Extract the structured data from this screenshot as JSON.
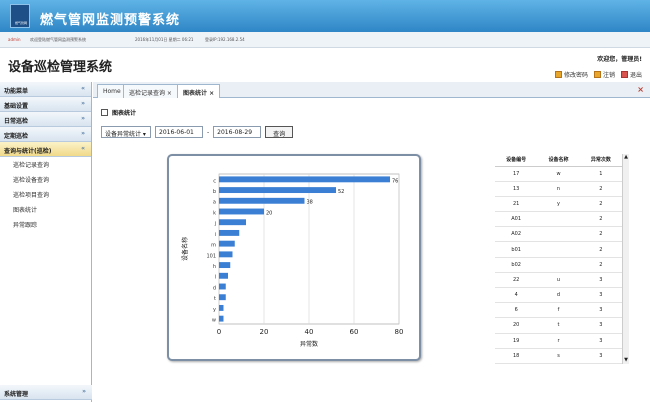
{
  "header": {
    "logo_text": "燃气管网",
    "system_title": "燃气管网监测预警系统",
    "user_link": "admin",
    "info_text": "欢迎登陆燃气管网监测预警系统",
    "datetime": "2016年11月01日 星期二 06:21",
    "ip_text": "登录IP:192.168.2.54"
  },
  "top": {
    "page_title": "设备巡检管理系统",
    "welcome": "欢迎您，管理员!",
    "links": [
      "修改密码",
      "注销",
      "退出"
    ]
  },
  "sidebar": {
    "sections": [
      {
        "label": "功能菜单",
        "chev": "«"
      },
      {
        "label": "基础设置",
        "chev": "»"
      },
      {
        "label": "日常巡检",
        "chev": "»"
      },
      {
        "label": "定期巡检",
        "chev": "»"
      },
      {
        "label": "查询与统计(巡检)",
        "chev": "«"
      }
    ],
    "items": [
      "巡检记录查询",
      "巡检设备查询",
      "巡检项目查询",
      "图表统计",
      "异常跟踪"
    ],
    "bottom_section": "系统管理",
    "bottom_chev": "»"
  },
  "tabs": [
    "Home",
    "巡检记录查询 ×",
    "图表统计 ×"
  ],
  "close_all": "×",
  "panel_title": "图表统计",
  "toolbar": {
    "select_value": "设备异常统计",
    "date_from": "2016-06-01",
    "sep": "-",
    "date_to": "2016-08-29",
    "query_label": "查询"
  },
  "chart_data": {
    "type": "bar",
    "orientation": "horizontal",
    "categories": [
      "c",
      "b",
      "a",
      "k",
      "j",
      "i",
      "m",
      "101",
      "h",
      "l",
      "d",
      "t",
      "y",
      "w"
    ],
    "values": [
      76,
      52,
      38,
      20,
      12,
      9,
      7,
      6,
      5,
      4,
      3,
      3,
      2,
      2
    ],
    "data_labels": [
      "76",
      "52",
      "38",
      "20",
      "",
      "",
      "",
      "",
      "",
      "",
      "",
      "",
      "",
      ""
    ],
    "xlabel": "异常数",
    "ylabel": "设备名称",
    "xlim": [
      0,
      80
    ],
    "xticks": [
      0,
      20,
      40,
      60,
      80
    ],
    "grid": true,
    "bar_color": "#3b7fd4"
  },
  "table": {
    "headers": [
      "设备编号",
      "设备名称",
      "异常次数"
    ],
    "rows": [
      [
        "17",
        "w",
        "1"
      ],
      [
        "13",
        "n",
        "2"
      ],
      [
        "21",
        "y",
        "2"
      ],
      [
        "A01",
        "",
        "2"
      ],
      [
        "A02",
        "",
        "2"
      ],
      [
        "b01",
        "",
        "2"
      ],
      [
        "b02",
        "",
        "2"
      ],
      [
        "22",
        "u",
        "3"
      ],
      [
        "4",
        "d",
        "3"
      ],
      [
        "6",
        "f",
        "3"
      ],
      [
        "20",
        "t",
        "3"
      ],
      [
        "19",
        "r",
        "3"
      ],
      [
        "18",
        "s",
        "3"
      ]
    ]
  }
}
